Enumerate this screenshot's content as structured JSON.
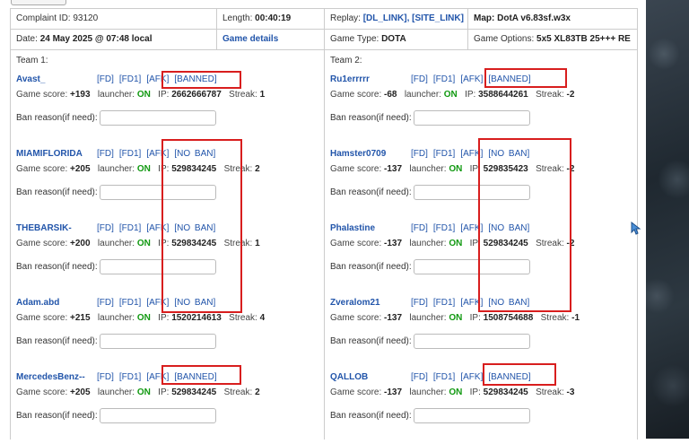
{
  "header": {
    "complaint_id": "Complaint ID: 93120",
    "length_label": "Length:",
    "length_value": "00:40:19",
    "replay_label": "Replay:",
    "replay_dl": "[DL_LINK]",
    "replay_sep": ",",
    "replay_site": "[SITE_LINK]",
    "map": "Map: DotA v6.83sf.w3x",
    "date_label": "Date:",
    "date_value": "24 May 2025 @ 07:48 local",
    "game_details": "Game details",
    "game_type_label": "Game Type:",
    "game_type_value": "DOTA",
    "game_options_label": "Game Options:",
    "game_options_value": "5x5 XL83TB 25+++ RE"
  },
  "labels": {
    "game_score": "Game score:",
    "launcher": "launcher:",
    "ip": "IP:",
    "streak": "Streak:",
    "ban_reason": "Ban reason(if need):",
    "fd": "[FD]",
    "fd1": "[FD1]",
    "afk": "[AFK]"
  },
  "colors": {
    "link": "#2255aa",
    "on": "#119911",
    "highlight_box": "#d81e1e"
  },
  "team1": {
    "label": "Team 1:",
    "players": [
      {
        "name": "Avast_",
        "ban_status": "[BANNED]",
        "score": "+193",
        "launcher": "ON",
        "ip": "2662666787",
        "streak": "1"
      },
      {
        "name": "MIAMIFLORIDA",
        "ban_status": "[NO BAN]",
        "score": "+205",
        "launcher": "ON",
        "ip": "529834245",
        "streak": "2"
      },
      {
        "name": "THEBARSIK-",
        "ban_status": "[NO BAN]",
        "score": "+200",
        "launcher": "ON",
        "ip": "529834245",
        "streak": "1"
      },
      {
        "name": "Adam.abd",
        "ban_status": "[NO BAN]",
        "score": "+215",
        "launcher": "ON",
        "ip": "1520214613",
        "streak": "4"
      },
      {
        "name": "MercedesBenz--",
        "ban_status": "[BANNED]",
        "score": "+205",
        "launcher": "ON",
        "ip": "529834245",
        "streak": "2"
      }
    ]
  },
  "team2": {
    "label": "Team 2:",
    "players": [
      {
        "name": "Ru1errrrr",
        "ban_status": "[BANNED]",
        "score": "-68",
        "launcher": "ON",
        "ip": "3588644261",
        "streak": "-2"
      },
      {
        "name": "Hamster0709",
        "ban_status": "[NO BAN]",
        "score": "-137",
        "launcher": "ON",
        "ip": "529835423",
        "streak": "-2"
      },
      {
        "name": "Phalastine",
        "ban_status": "[NO BAN]",
        "score": "-137",
        "launcher": "ON",
        "ip": "529834245",
        "streak": "-2"
      },
      {
        "name": "Zveralom21",
        "ban_status": "[NO BAN]",
        "score": "-137",
        "launcher": "ON",
        "ip": "1508754688",
        "streak": "-1"
      },
      {
        "name": "QALLOB",
        "ban_status": "[BANNED]",
        "score": "-137",
        "launcher": "ON",
        "ip": "529834245",
        "streak": "-3"
      }
    ]
  }
}
